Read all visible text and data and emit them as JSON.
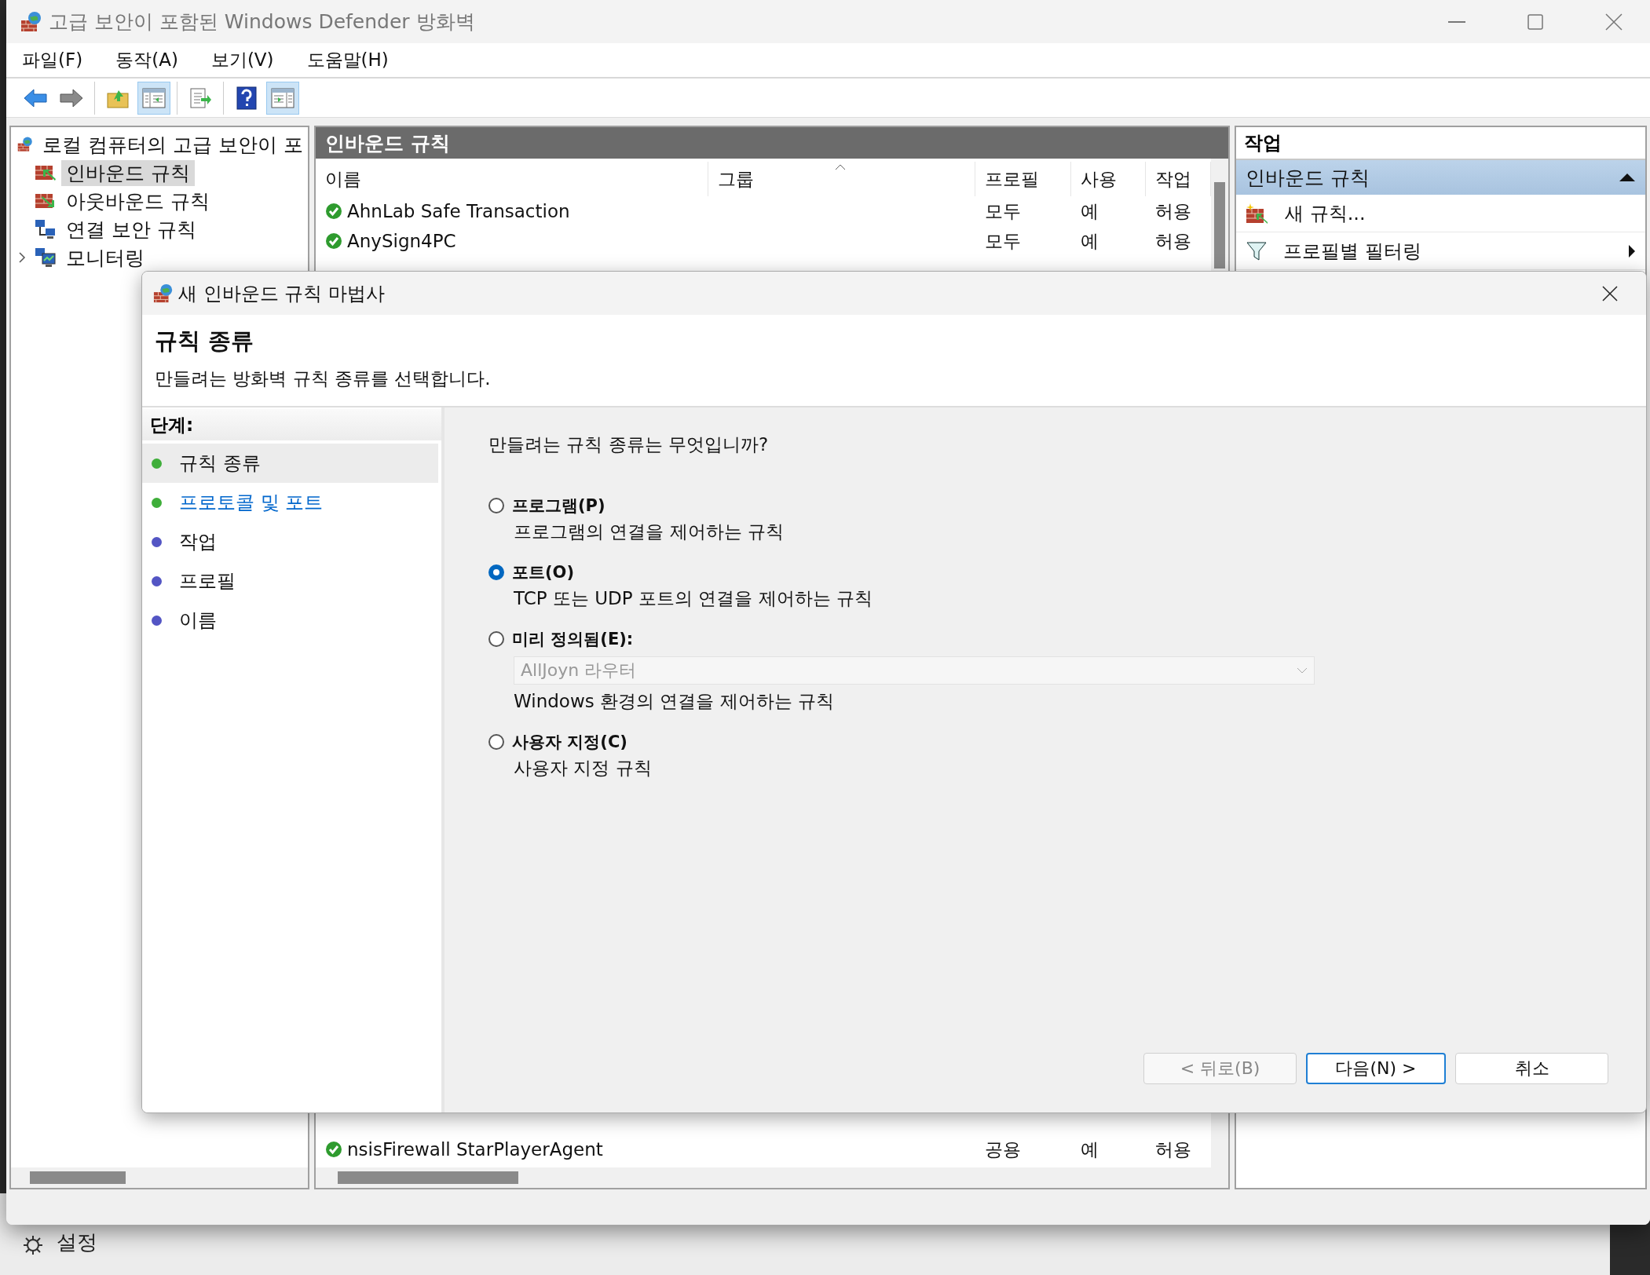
{
  "window": {
    "title": "고급 보안이 포함된 Windows Defender 방화벽"
  },
  "menu": [
    "파일(F)",
    "동작(A)",
    "보기(V)",
    "도움말(H)"
  ],
  "toolbar": [
    [
      {
        "kind": "back",
        "pressed": false
      },
      {
        "kind": "forward",
        "pressed": false
      }
    ],
    [
      {
        "kind": "up",
        "pressed": false
      },
      {
        "kind": "tree",
        "pressed": true
      }
    ],
    [
      {
        "kind": "export",
        "pressed": false
      }
    ],
    [
      {
        "kind": "help",
        "pressed": false
      },
      {
        "kind": "actionpane",
        "pressed": true
      }
    ]
  ],
  "tree": {
    "label": "로컬 컴퓨터의 고급 보안이 포",
    "children": [
      {
        "label": "인바운드 규칙",
        "kind": "inbound",
        "selected": true
      },
      {
        "label": "아웃바운드 규칙",
        "kind": "outbound",
        "selected": false
      },
      {
        "label": "연결 보안 규칙",
        "kind": "connection",
        "selected": false
      },
      {
        "label": "모니터링",
        "kind": "monitor",
        "selected": false,
        "expanded": false
      }
    ]
  },
  "rules": {
    "title": "인바운드 규칙",
    "columns": [
      "이름",
      "그룹",
      "프로필",
      "사용",
      "작업"
    ],
    "rows": [
      {
        "name": "AhnLab Safe Transaction",
        "profile": "모두",
        "enabled": "예",
        "action": "허용"
      },
      {
        "name": "AnySign4PC",
        "profile": "모두",
        "enabled": "예",
        "action": "허용"
      },
      {
        "name": "nsisFirewall StarPlayerAgent",
        "profile": "공용",
        "enabled": "예",
        "action": "허용"
      }
    ]
  },
  "actions": {
    "title": "작업",
    "section": "인바운드 규칙",
    "expanded": true,
    "items": [
      {
        "label": "새 규칙...",
        "kind": "new"
      },
      {
        "label": "프로필별 필터링",
        "kind": "filter"
      }
    ]
  },
  "dialog": {
    "title": "새 인바운드 규칙 마법사",
    "heading": "규칙 종류",
    "subtitle": "만들려는 방화벽 규칙 종류를 선택합니다.",
    "steps_title": "단계:",
    "steps": [
      {
        "label": "규칙 종류",
        "selected": true,
        "kind": "plain",
        "color": "#3fae3a"
      },
      {
        "label": "프로토콜 및 포트",
        "selected": false,
        "kind": "link",
        "color": "#3fae3a"
      },
      {
        "label": "작업",
        "selected": false,
        "kind": "plain",
        "color": "#5355c4"
      },
      {
        "label": "프로필",
        "selected": false,
        "kind": "plain",
        "color": "#5355c4"
      },
      {
        "label": "이름",
        "selected": false,
        "kind": "plain",
        "color": "#5355c4"
      }
    ],
    "question": "만들려는 규칙 종류는 무엇입니까?",
    "options": [
      {
        "label": "프로그램(P)",
        "description": "프로그램의 연결을 제어하는 규칙",
        "selected": false
      },
      {
        "label": "포트(O)",
        "description": "TCP 또는 UDP 포트의 연결을 제어하는 규칙",
        "selected": true
      },
      {
        "label": "미리 정의됨(E):",
        "description": "Windows 환경의 연결을 제어하는 규칙",
        "selected": false,
        "dropdown": {
          "value": "AllJoyn 라우터",
          "disabled": true
        }
      },
      {
        "label": "사용자 지정(C)",
        "description": "사용자 지정 규칙",
        "selected": false
      }
    ],
    "buttons": [
      {
        "label": "< 뒤로(B)",
        "disabled": true,
        "default": false
      },
      {
        "label": "다음(N) >",
        "disabled": false,
        "default": true
      },
      {
        "label": "취소",
        "disabled": false,
        "default": false
      }
    ]
  },
  "background_window": {
    "item": "설정"
  }
}
